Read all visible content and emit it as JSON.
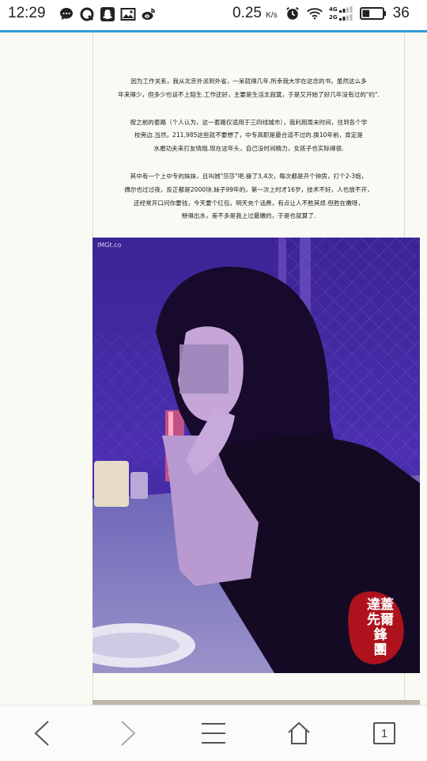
{
  "status_bar": {
    "time": "12:29",
    "speed_value": "0.25",
    "speed_unit": "K/s",
    "battery_percent": "36",
    "icons_left": [
      "message-icon",
      "q-app-icon",
      "snapchat-ghost-icon",
      "image-icon",
      "weibo-icon"
    ],
    "icons_right": [
      "alarm-icon",
      "wifi-icon",
      "signal-4g-icon",
      "signal-2g-icon",
      "battery-icon"
    ],
    "signal_labels": [
      "4G",
      "2G"
    ]
  },
  "page_load_progress": 1.0,
  "article": {
    "paragraphs": [
      [
        "因为工作关系，我从北京外派到外省，一呆就得几年.所幸我大学在这念的书，虽然这么多",
        "年来得少，但多少也谈不上陌生.工作还好，主要是生活太寂寞，于是又开始了好几年没有过的\"约\"."
      ],
      [
        "按之前的套路（个人认为，这一套路仅适用于三四线城市），我利用周末时间，往到各个学",
        "校旁边.当然，211,985这些就不要想了，中专高职是最合适不过的.换10年前，肯定是",
        "水磨功夫来打友情炮.现在这年头，自己没时间精力，女孩子也实际得很."
      ],
      [
        "其中有一个上中专的妹妹，且叫她\"莎莎\"吧.操了3,4次，每次都是开个钟房，打个2-3炮，",
        "偶尔也过过夜，反正都是2000块.妹子99年的，第一次上时才16岁，技术不好，人也放不开，",
        "还经常开口问你要钱，今天要个红包，明天充个话费，有点让人不胜其烦.但胜在嫩呀，",
        "掰得出水，差不多是我上过最嫩的，于是也就算了."
      ]
    ]
  },
  "photo": {
    "watermark_small": "IMGt.co",
    "seal_text": [
      "達蓋",
      "先爾",
      "鋒",
      "團"
    ],
    "accent_colors": [
      "#4a2fb8",
      "#1b0c44",
      "#c81a1a"
    ]
  },
  "navbar": {
    "back_label": "<",
    "forward_label": ">",
    "tabs_count": "1"
  }
}
